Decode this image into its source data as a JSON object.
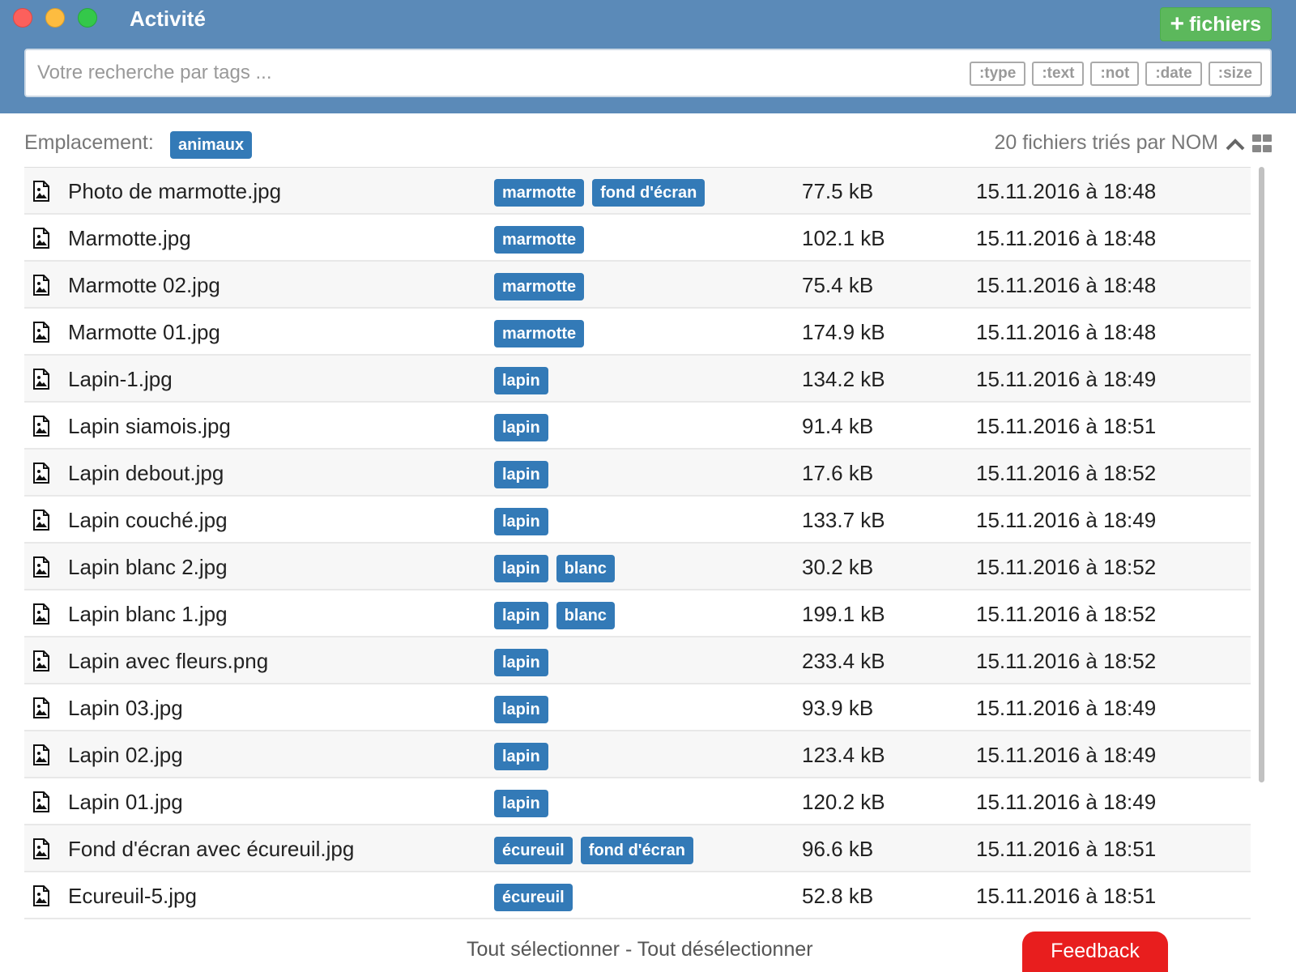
{
  "window": {
    "title": "Activité"
  },
  "header": {
    "add_files_label": "fichiers",
    "search_placeholder": "Votre recherche par tags ...",
    "filters": [
      ":type",
      ":text",
      ":not",
      ":date",
      ":size"
    ]
  },
  "toolbar": {
    "location_label": "Emplacement:",
    "location_value": "animaux",
    "sort_info": "20 fichiers triés par NOM"
  },
  "files": [
    {
      "name": "Photo de marmotte.jpg",
      "tags": [
        "marmotte",
        "fond d'écran"
      ],
      "size": "77.5 kB",
      "date": "15.11.2016 à 18:48"
    },
    {
      "name": "Marmotte.jpg",
      "tags": [
        "marmotte"
      ],
      "size": "102.1 kB",
      "date": "15.11.2016 à 18:48"
    },
    {
      "name": "Marmotte 02.jpg",
      "tags": [
        "marmotte"
      ],
      "size": "75.4 kB",
      "date": "15.11.2016 à 18:48"
    },
    {
      "name": "Marmotte 01.jpg",
      "tags": [
        "marmotte"
      ],
      "size": "174.9 kB",
      "date": "15.11.2016 à 18:48"
    },
    {
      "name": "Lapin-1.jpg",
      "tags": [
        "lapin"
      ],
      "size": "134.2 kB",
      "date": "15.11.2016 à 18:49"
    },
    {
      "name": "Lapin siamois.jpg",
      "tags": [
        "lapin"
      ],
      "size": "91.4 kB",
      "date": "15.11.2016 à 18:51"
    },
    {
      "name": "Lapin debout.jpg",
      "tags": [
        "lapin"
      ],
      "size": "17.6 kB",
      "date": "15.11.2016 à 18:52"
    },
    {
      "name": "Lapin couché.jpg",
      "tags": [
        "lapin"
      ],
      "size": "133.7 kB",
      "date": "15.11.2016 à 18:49"
    },
    {
      "name": "Lapin blanc 2.jpg",
      "tags": [
        "lapin",
        "blanc"
      ],
      "size": "30.2 kB",
      "date": "15.11.2016 à 18:52"
    },
    {
      "name": "Lapin blanc 1.jpg",
      "tags": [
        "lapin",
        "blanc"
      ],
      "size": "199.1 kB",
      "date": "15.11.2016 à 18:52"
    },
    {
      "name": "Lapin avec fleurs.png",
      "tags": [
        "lapin"
      ],
      "size": "233.4 kB",
      "date": "15.11.2016 à 18:52"
    },
    {
      "name": "Lapin 03.jpg",
      "tags": [
        "lapin"
      ],
      "size": "93.9 kB",
      "date": "15.11.2016 à 18:49"
    },
    {
      "name": "Lapin 02.jpg",
      "tags": [
        "lapin"
      ],
      "size": "123.4 kB",
      "date": "15.11.2016 à 18:49"
    },
    {
      "name": "Lapin 01.jpg",
      "tags": [
        "lapin"
      ],
      "size": "120.2 kB",
      "date": "15.11.2016 à 18:49"
    },
    {
      "name": "Fond d'écran avec écureuil.jpg",
      "tags": [
        "écureuil",
        "fond d'écran"
      ],
      "size": "96.6 kB",
      "date": "15.11.2016 à 18:51"
    },
    {
      "name": "Ecureuil-5.jpg",
      "tags": [
        "écureuil"
      ],
      "size": "52.8 kB",
      "date": "15.11.2016 à 18:51"
    }
  ],
  "footer": {
    "select_all": "Tout sélectionner",
    "separator": " - ",
    "deselect_all": "Tout désélectionner",
    "feedback": "Feedback"
  },
  "colors": {
    "header_bg": "#5b8ab8",
    "tag_bg": "#337ab7",
    "add_button_bg": "#5cb85c",
    "feedback_bg": "#e81e1e"
  },
  "icons": {
    "file_row": "image-file-icon",
    "sort": "chevron-up-icon",
    "view": "grid-view-icon",
    "add": "plus-icon"
  }
}
